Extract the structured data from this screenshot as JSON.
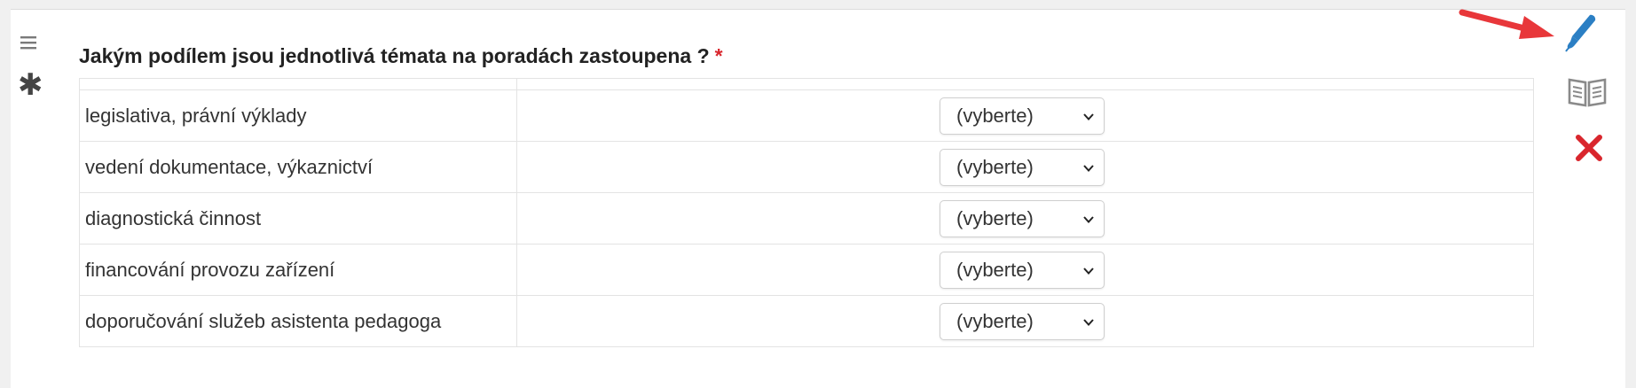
{
  "question": {
    "title": "Jakým podílem jsou jednotlivá témata na poradách zastoupena ?",
    "required_marker": "*"
  },
  "rows": [
    {
      "label": "legislativa, právní výklady",
      "selected": "(vyberte)"
    },
    {
      "label": "vedení dokumentace, výkaznictví",
      "selected": "(vyberte)"
    },
    {
      "label": "diagnostická činnost",
      "selected": "(vyberte)"
    },
    {
      "label": "financování provozu zařízení",
      "selected": "(vyberte)"
    },
    {
      "label": "doporučování služeb asistenta pedagoga",
      "selected": "(vyberte)"
    }
  ],
  "icons": {
    "drag": "hamburger-icon",
    "required": "asterisk-icon",
    "edit": "pencil-icon",
    "preview": "open-book-icon",
    "delete": "x-icon",
    "annotation": "red-arrow-icon"
  },
  "colors": {
    "edit": "#2b7fc4",
    "delete": "#d9262d",
    "required": "#d9262d",
    "annotation": "#e8373a"
  }
}
